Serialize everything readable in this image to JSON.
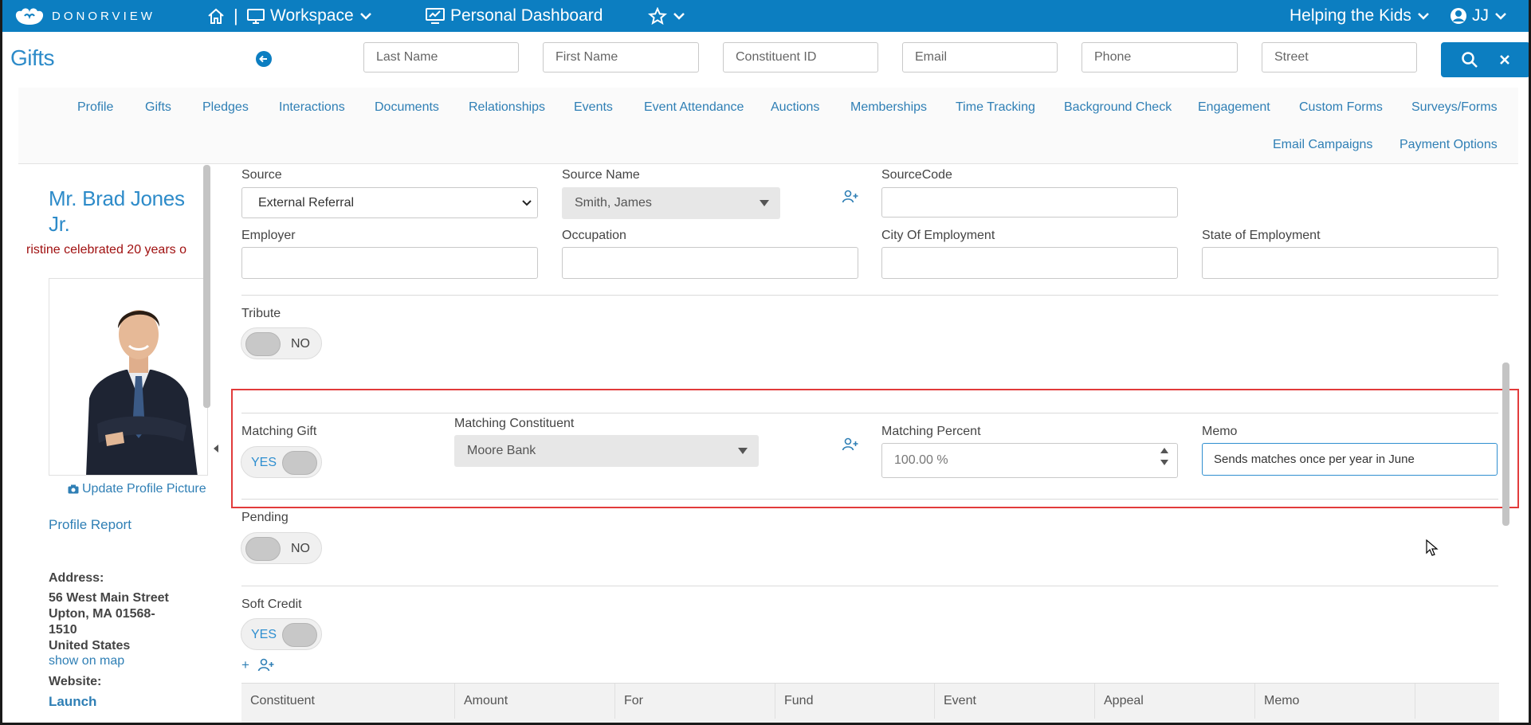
{
  "topbar": {
    "logo_text": "DONORVIEW",
    "workspace_label": "Workspace",
    "dashboard_label": "Personal Dashboard",
    "org_label": "Helping the Kids",
    "user_label": "JJ"
  },
  "page": {
    "title": "Gifts"
  },
  "search": {
    "last_name_placeholder": "Last Name",
    "first_name_placeholder": "First Name",
    "constituent_id_placeholder": "Constituent ID",
    "email_placeholder": "Email",
    "phone_placeholder": "Phone",
    "street_placeholder": "Street"
  },
  "tabs": {
    "row1": [
      "Profile",
      "Gifts",
      "Pledges",
      "Interactions",
      "Documents",
      "Relationships",
      "Events",
      "Event Attendance",
      "Auctions",
      "Memberships",
      "Time Tracking",
      "Background Check",
      "Engagement",
      "Custom Forms",
      "Surveys/Forms"
    ],
    "row2": [
      "Email Campaigns",
      "Payment Options"
    ]
  },
  "profile": {
    "name": "Mr. Brad Jones Jr.",
    "ticker": "ristine celebrated 20 years o",
    "update_picture": "Update Profile Picture",
    "profile_report": "Profile Report",
    "address_label": "Address:",
    "address_line1": "56 West Main Street",
    "address_line2": "Upton, MA 01568-1510",
    "address_line3": "United States",
    "show_on_map": "show on map",
    "website_label": "Website:",
    "launch": "Launch"
  },
  "form": {
    "source_label": "Source",
    "source_value": "External Referral",
    "source_name_label": "Source Name",
    "source_name_value": "Smith, James",
    "source_code_label": "SourceCode",
    "source_code_value": "",
    "employer_label": "Employer",
    "occupation_label": "Occupation",
    "city_employment_label": "City Of Employment",
    "state_employment_label": "State of Employment",
    "tribute_label": "Tribute",
    "tribute_value": "NO",
    "matching_gift_label": "Matching Gift",
    "matching_gift_value": "YES",
    "matching_constituent_label": "Matching Constituent",
    "matching_constituent_value": "Moore Bank",
    "matching_percent_label": "Matching Percent",
    "matching_percent_value": "100.00 %",
    "memo_label": "Memo",
    "memo_value": "Sends matches once per year in June",
    "pending_label": "Pending",
    "pending_value": "NO",
    "soft_credit_label": "Soft Credit",
    "soft_credit_value": "YES",
    "plus_label": "+"
  },
  "soft_credit_table": {
    "columns": [
      "Constituent",
      "Amount",
      "For",
      "Fund",
      "Event",
      "Appeal",
      "Memo",
      ""
    ]
  },
  "colors": {
    "brand_blue": "#0c7ec1",
    "link_blue": "#2f7fb5",
    "highlight_red": "#e23b3b",
    "ticker_red": "#a01010"
  }
}
